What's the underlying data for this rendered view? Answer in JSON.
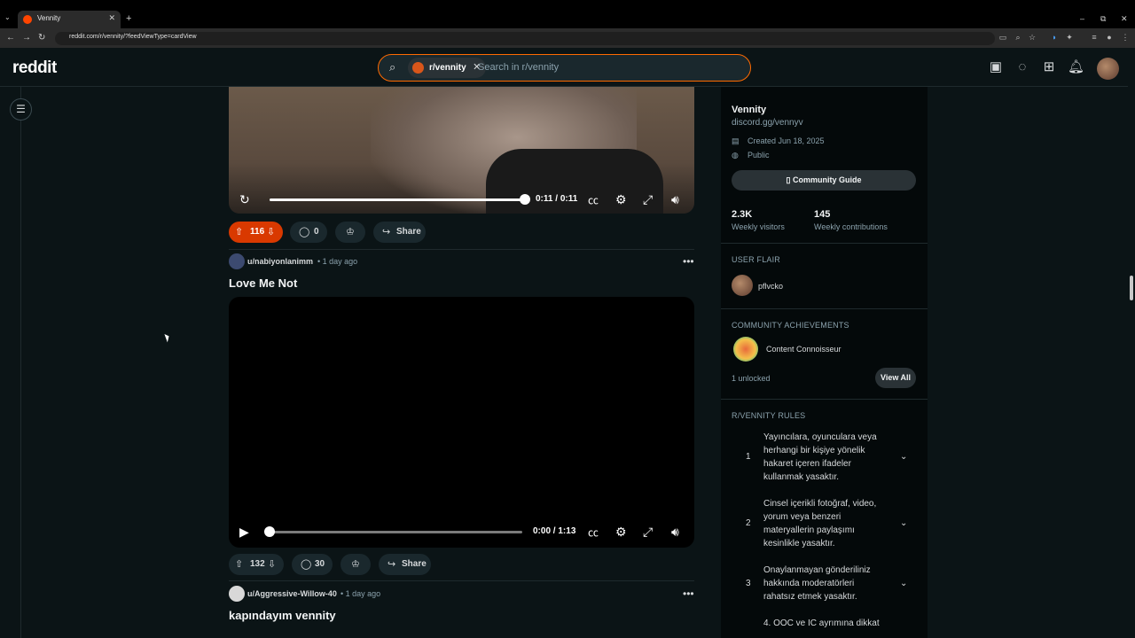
{
  "browser": {
    "tab_title": "Vennity",
    "tab_close": "✕",
    "new_tab": "+",
    "url": "reddit.com/r/vennity/?feedViewType=cardView",
    "win_minimize": "–",
    "win_restore": "⧉",
    "win_close": "✕"
  },
  "header": {
    "logo": "reddit",
    "search": {
      "chip_label": "r/vennity",
      "chip_close": "✕",
      "placeholder": "Search in r/vennity"
    }
  },
  "posts": [
    {
      "video": {
        "current": "0:11",
        "separator": "/",
        "duration": "0:11",
        "progress": 1.0
      },
      "votes": "116",
      "comments": "0",
      "share": "Share"
    },
    {
      "author": "u/nabiyonlanimm",
      "age": "• 1 day ago",
      "title": "Love Me Not",
      "video": {
        "current": "0:00",
        "separator": "/",
        "duration": "1:13",
        "progress": 0.0
      },
      "votes": "132",
      "comments": "30",
      "share": "Share"
    },
    {
      "author": "u/Aggressive-Willow-40",
      "age": "• 1 day ago",
      "title": "kapındayım vennity"
    }
  ],
  "sidebar": {
    "name": "Vennity",
    "link": "discord.gg/vennyv",
    "created": "Created Jun 18, 2025",
    "visibility": "Public",
    "guide_button": "Community Guide",
    "stats": [
      {
        "value": "2.3K",
        "label": "Weekly visitors"
      },
      {
        "value": "145",
        "label": "Weekly contributions"
      }
    ],
    "user_flair_heading": "USER FLAIR",
    "user_flair_name": "pflvcko",
    "achievements_heading": "COMMUNITY ACHIEVEMENTS",
    "achievement_name": "Content Connoisseur",
    "unlocked": "1 unlocked",
    "view_all": "View All",
    "rules_heading": "R/VENNITY RULES",
    "rules": [
      {
        "num": "1",
        "text": "Yayıncılara, oyunculara veya herhangi bir kişiye yönelik hakaret içeren ifadeler kullanmak yasaktır."
      },
      {
        "num": "2",
        "text": "Cinsel içerikli fotoğraf, video, yorum veya benzeri materyallerin paylaşımı kesinlikle yasaktır."
      },
      {
        "num": "3",
        "text": "Onaylanmayan gönderiliniz hakkında moderatörleri rahatsız etmek yasaktır."
      },
      {
        "num": "",
        "text": "4. OOC ve IC ayrımına dikkat"
      }
    ]
  },
  "colors": {
    "accent": "#ff4500",
    "vote_active": "#d93900",
    "background": "#0b1416"
  }
}
